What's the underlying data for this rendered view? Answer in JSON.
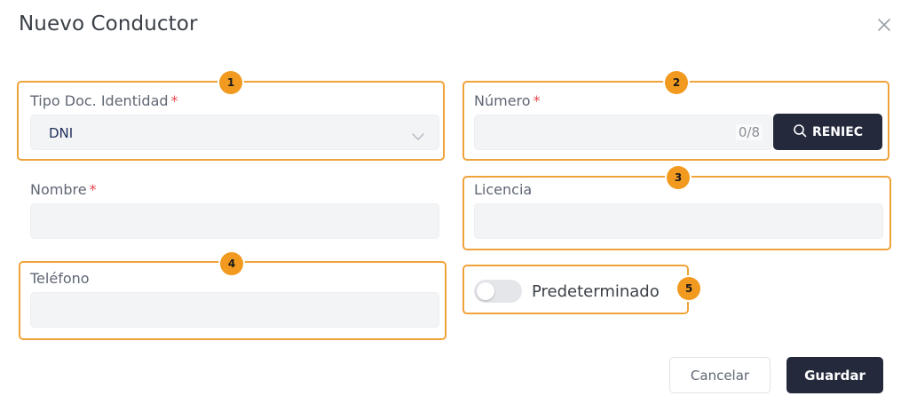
{
  "dialog": {
    "title": "Nuevo Conductor",
    "close_icon": "close-icon"
  },
  "form": {
    "tipo_doc": {
      "label": "Tipo Doc. Identidad",
      "required_mark": "*",
      "value": "DNI",
      "icon": "chevron-down-icon"
    },
    "numero": {
      "label": "Número",
      "required_mark": "*",
      "value": "",
      "counter": "0/8",
      "search_button_label": "RENIEC",
      "search_icon": "search-icon"
    },
    "nombre": {
      "label": "Nombre",
      "required_mark": "*",
      "value": ""
    },
    "licencia": {
      "label": "Licencia",
      "value": ""
    },
    "telefono": {
      "label": "Teléfono",
      "value": ""
    },
    "predeterminado": {
      "label": "Predeterminado",
      "checked": false
    }
  },
  "footer": {
    "cancel_label": "Cancelar",
    "save_label": "Guardar"
  },
  "annotations": {
    "badges": [
      "1",
      "2",
      "3",
      "4",
      "5"
    ]
  },
  "colors": {
    "primary": "#24293b",
    "highlight": "#f0a33a",
    "badge": "#f29a1f",
    "required": "#e5484d",
    "field_bg": "#f3f4f6"
  }
}
